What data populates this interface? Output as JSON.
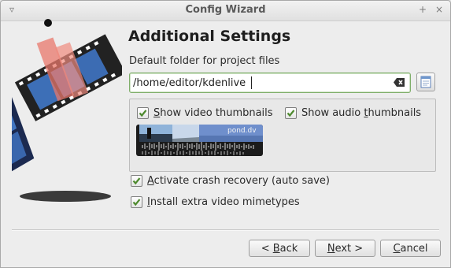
{
  "window": {
    "title": "Config Wizard",
    "menu_glyph": "▿",
    "keep_glyph": "+",
    "close_glyph": "×"
  },
  "page": {
    "heading": "Additional Settings",
    "folder_label": "Default folder for project files",
    "folder_value": "/home/editor/kdenlive"
  },
  "thumbnails": {
    "show_video": {
      "label_prefix": "",
      "accel": "S",
      "label_rest": "how video thumbnails",
      "checked": true
    },
    "show_audio": {
      "label_prefix": "Show audio ",
      "accel": "t",
      "label_rest": "humbnails",
      "checked": true
    },
    "preview_caption": "pond.dv"
  },
  "options": {
    "crash_recovery": {
      "accel": "A",
      "label_rest": "ctivate crash recovery (auto save)",
      "checked": true
    },
    "extra_mimetypes": {
      "accel": "I",
      "label_rest": "nstall extra video mimetypes",
      "checked": true
    }
  },
  "buttons": {
    "back": {
      "prefix": "< ",
      "accel": "B",
      "rest": "ack"
    },
    "next": {
      "prefix": "",
      "accel": "N",
      "rest": "ext >"
    },
    "cancel": {
      "prefix": "",
      "accel": "C",
      "rest": "ancel"
    }
  },
  "icons": {
    "clear": "clear-text-icon",
    "browse": "folder-open-icon",
    "logo": "kdenlive-film-logo"
  },
  "colors": {
    "focus_border": "#7fae6a",
    "checkmark": "#4e8a2e"
  }
}
